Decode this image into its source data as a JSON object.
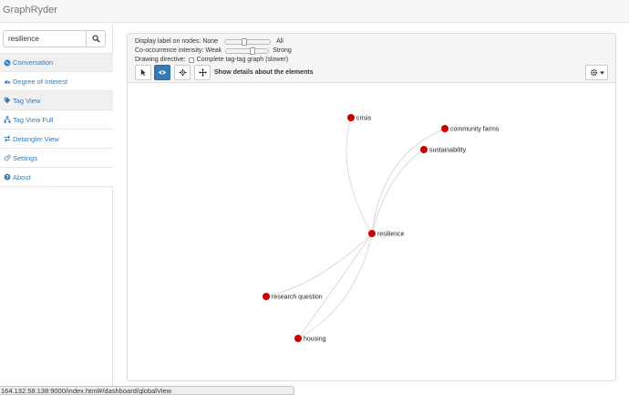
{
  "app": {
    "title": "GraphRyder"
  },
  "search": {
    "value": "resilience"
  },
  "sidebar": {
    "items": [
      {
        "label": "Conversation",
        "icon": "globe-icon"
      },
      {
        "label": "Degree of Interest",
        "icon": "dashboard-icon"
      },
      {
        "label": "Tag View",
        "icon": "tag-icon"
      },
      {
        "label": "Tag View Full",
        "icon": "sitemap-icon"
      },
      {
        "label": "Detangler View",
        "icon": "exchange-icon"
      },
      {
        "label": "Settings",
        "icon": "cogs-icon"
      },
      {
        "label": "About",
        "icon": "question-icon"
      }
    ]
  },
  "controls": {
    "label_prefix": "Display label on nodes: None",
    "label_suffix": "All",
    "label_level": 0.4,
    "cooc_prefix": "Co-occurrence intensity: Weak",
    "cooc_suffix": "Strong",
    "cooc_level": 0.62,
    "drawing_prefix": "Drawing directive:",
    "drawing_option": "Complete tag-tag graph (slower)",
    "details_label": "Show details about the elements"
  },
  "graph": {
    "node_color": "#cc0000",
    "edge_color": "#d3d3d3",
    "nodes": [
      {
        "label": "crisis"
      },
      {
        "label": "community farms"
      },
      {
        "label": "sustainability"
      },
      {
        "label": "resilience"
      },
      {
        "label": "research question"
      },
      {
        "label": "housing"
      }
    ]
  },
  "status": {
    "url": "164.132.58.138:9000/index.html#/dashboard/globalView"
  },
  "colors": {
    "accent": "#337ab7",
    "link": "#337ab7"
  }
}
